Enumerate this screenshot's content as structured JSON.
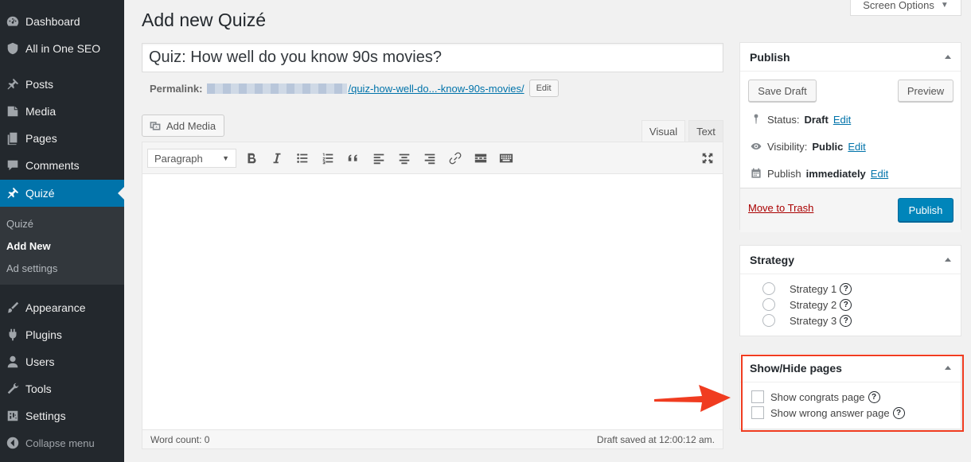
{
  "sidebar": {
    "items": [
      {
        "label": "Dashboard",
        "icon": "dashboard-icon"
      },
      {
        "label": "All in One SEO",
        "icon": "shield-icon"
      },
      {
        "label": "Posts",
        "icon": "pin-icon"
      },
      {
        "label": "Media",
        "icon": "media-icon"
      },
      {
        "label": "Pages",
        "icon": "pages-icon"
      },
      {
        "label": "Comments",
        "icon": "comment-icon"
      },
      {
        "label": "Quizé",
        "icon": "pin-icon"
      },
      {
        "label": "Appearance",
        "icon": "brush-icon"
      },
      {
        "label": "Plugins",
        "icon": "plugin-icon"
      },
      {
        "label": "Users",
        "icon": "user-icon"
      },
      {
        "label": "Tools",
        "icon": "wrench-icon"
      },
      {
        "label": "Settings",
        "icon": "settings-icon"
      }
    ],
    "submenu": [
      "Quizé",
      "Add New",
      "Ad settings"
    ],
    "collapse_label": "Collapse menu",
    "accent_color": "#0073aa"
  },
  "screen_options": {
    "label": "Screen Options"
  },
  "page": {
    "title": "Add new Quizé"
  },
  "post_title": {
    "value": "Quiz: How well do you know 90s movies?"
  },
  "permalink": {
    "label": "Permalink:",
    "slug": "/quiz-how-well-do...-know-90s-movies/",
    "edit_label": "Edit"
  },
  "editor": {
    "add_media_label": "Add Media",
    "tabs": {
      "visual": "Visual",
      "text": "Text"
    },
    "format_select": "Paragraph",
    "word_count": "Word count: 0",
    "draft_saved": "Draft saved at 12:00:12 am."
  },
  "publish_box": {
    "title": "Publish",
    "save_draft": "Save Draft",
    "preview": "Preview",
    "status_label": "Status:",
    "status_value": "Draft",
    "visibility_label": "Visibility:",
    "visibility_value": "Public",
    "publish_label": "Publish",
    "publish_value": "immediately",
    "edit_label": "Edit",
    "trash_label": "Move to Trash",
    "publish_button": "Publish"
  },
  "strategy_box": {
    "title": "Strategy",
    "options": [
      "Strategy 1",
      "Strategy 2",
      "Strategy 3"
    ]
  },
  "showhide_box": {
    "title": "Show/Hide pages",
    "options": [
      "Show congrats page",
      "Show wrong answer page"
    ],
    "highlight_color": "#f03c20"
  }
}
